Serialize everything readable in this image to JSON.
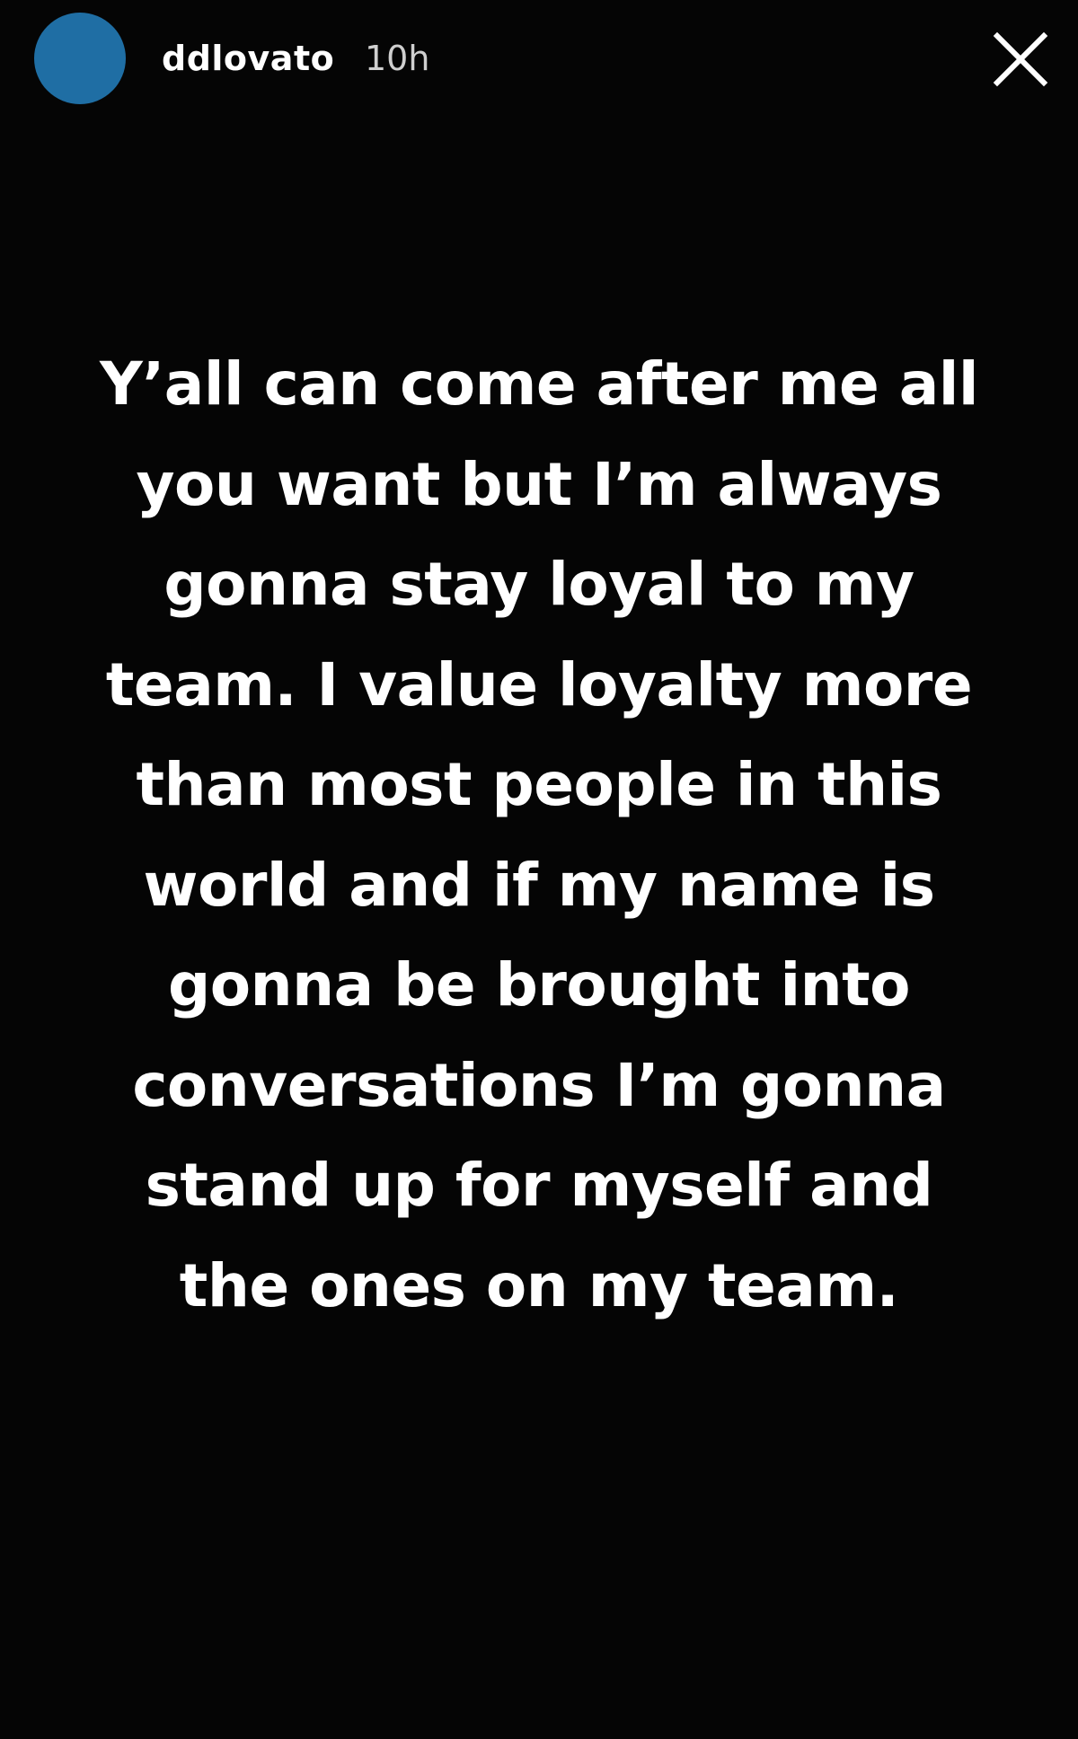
{
  "header": {
    "username": "ddlovato",
    "timestamp": "10h",
    "avatar_color": "#1f6ea4",
    "close_icon": "close-icon"
  },
  "story": {
    "background_color": "#050505",
    "text_color": "#ffffff",
    "lines": [
      "Y’all can come after me all",
      "you want but I’m always",
      "gonna stay loyal to my",
      "team. I value loyalty more",
      "than most people in this",
      "world and if my name is",
      "gonna be brought into",
      "conversations I’m gonna",
      "stand up for myself and",
      "the ones on my team."
    ]
  }
}
